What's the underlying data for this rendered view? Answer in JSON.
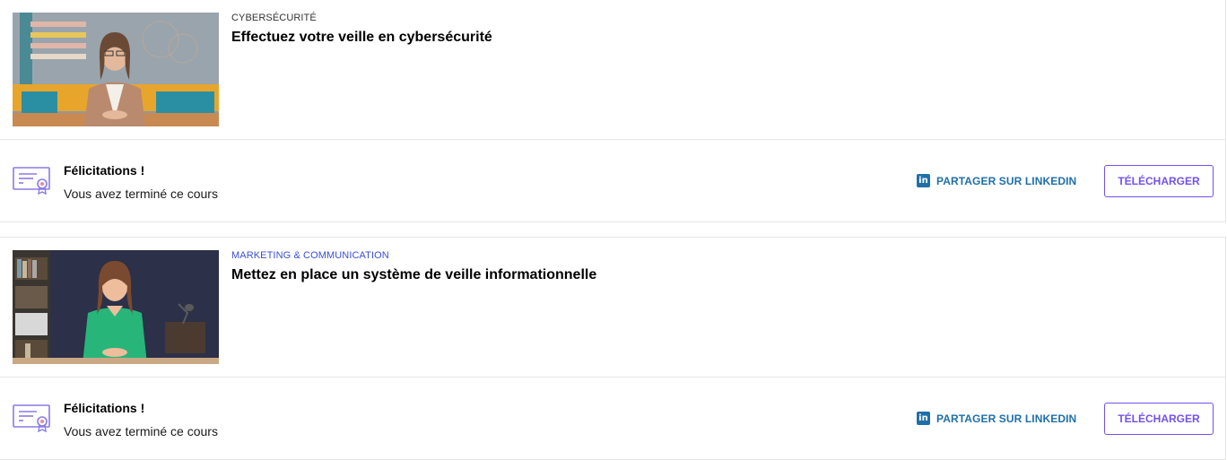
{
  "courses": [
    {
      "category": "CYBERSÉCURITÉ",
      "category_color": "#333333",
      "title": "Effectuez votre veille en cybersécurité",
      "thumbnail": "woman-instructor-office",
      "certificate": {
        "heading": "Félicitations !",
        "message": "Vous avez terminé ce cours",
        "linkedin_label": "PARTAGER SUR LINKEDIN",
        "download_label": "TÉLÉCHARGER"
      }
    },
    {
      "category": "MARKETING & COMMUNICATION",
      "category_color": "#3b4fd8",
      "title": "Mettez en place un système de veille informationnelle",
      "thumbnail": "woman-instructor-bookshelf",
      "certificate": {
        "heading": "Félicitations !",
        "message": "Vous avez terminé ce cours",
        "linkedin_label": "PARTAGER SUR LINKEDIN",
        "download_label": "TÉLÉCHARGER"
      }
    }
  ],
  "colors": {
    "accent": "#7451eb",
    "linkedin": "#1f6fa8",
    "border": "#e6e6ea"
  }
}
